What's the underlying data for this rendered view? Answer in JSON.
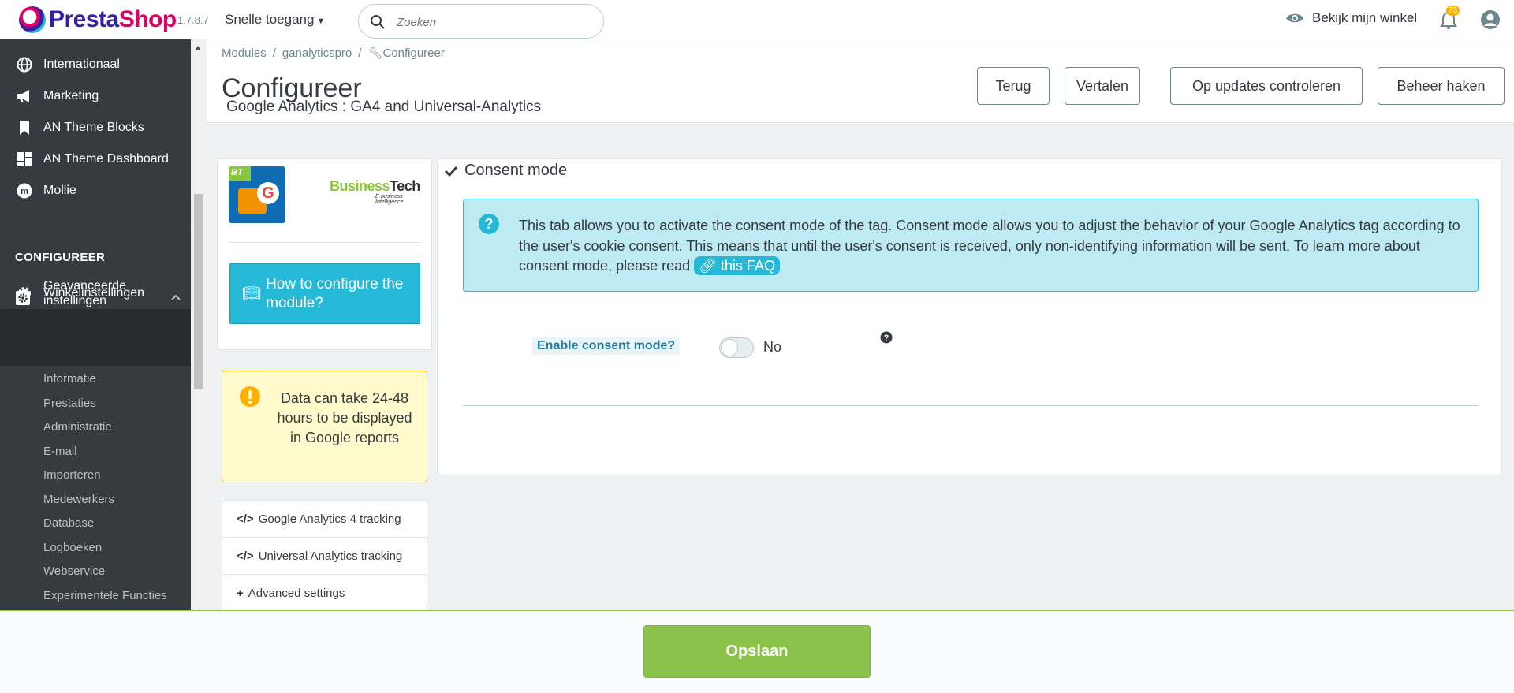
{
  "topbar": {
    "logo_part1": "Presta",
    "logo_part2": "Shop",
    "version": "1.7.8.7",
    "quick_access": "Snelle toegang",
    "search_placeholder": "Zoeken",
    "view_shop": "Bekijk mijn winkel",
    "notification_count": "73"
  },
  "sidebar": {
    "items": [
      {
        "label": "Internationaal",
        "icon": "globe-icon"
      },
      {
        "label": "Marketing",
        "icon": "megaphone-icon"
      },
      {
        "label": "AN Theme Blocks",
        "icon": "bookmark-icon"
      },
      {
        "label": "AN Theme Dashboard",
        "icon": "dashboard-icon"
      },
      {
        "label": "Mollie",
        "icon": "mollie-icon"
      }
    ],
    "section_title": "CONFIGUREER",
    "shop_settings": "Winkelinstellingen",
    "advanced_settings": "Geavanceerde instellingen",
    "sub_items": [
      "Informatie",
      "Prestaties",
      "Administratie",
      "E-mail",
      "Importeren",
      "Medewerkers",
      "Database",
      "Logboeken",
      "Webservice",
      "Experimentele Functies"
    ]
  },
  "header": {
    "breadcrumb": [
      "Modules",
      "ganalyticspro",
      "Configureer"
    ],
    "title": "Configureer",
    "subtitle": "Google Analytics : GA4 and Universal-Analytics",
    "buttons": [
      "Terug",
      "Vertalen",
      "Op updates controleren",
      "Beheer haken"
    ]
  },
  "left_panel": {
    "module_icon_badge": "BT",
    "brand_name_1": "Business",
    "brand_name_2": "Tech",
    "brand_tagline": "E-business Intelligence",
    "howto_label": "How to configure the module?",
    "warning_text": "Data can take 24-48 hours to be displayed in Google reports",
    "tabs": [
      {
        "label": "Google Analytics 4 tracking",
        "icon": "code-icon"
      },
      {
        "label": "Universal Analytics tracking",
        "icon": "code-icon"
      },
      {
        "label": "Advanced settings",
        "icon": "plus-icon"
      }
    ]
  },
  "main_panel": {
    "title": "Consent mode",
    "info_text": "This tab allows you to activate the consent mode of the tag. Consent mode allows you to adjust the behavior of your Google Analytics tag according to the user's cookie consent. This means that until the user's consent is received, only non-identifying information will be sent. To learn more about consent mode, please read",
    "faq_link": "this FAQ",
    "field_label": "Enable consent mode?",
    "toggle_value": "No"
  },
  "footer": {
    "save_label": "Opslaan"
  },
  "colors": {
    "brand_blue": "#25b9d7",
    "brand_pink": "#df0067",
    "brand_purple": "#34219e",
    "sidebar_bg": "#363a41",
    "save_green": "#8bc34a",
    "warning_yellow": "#fab000"
  }
}
